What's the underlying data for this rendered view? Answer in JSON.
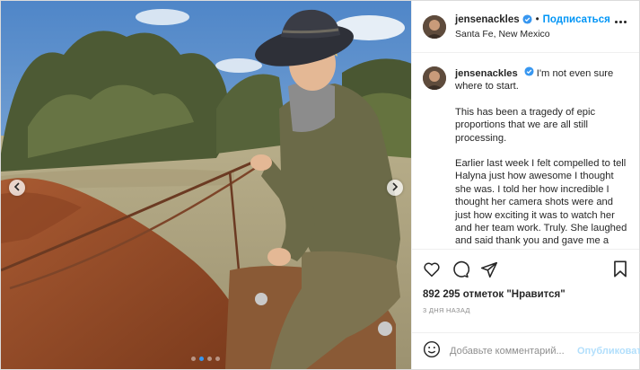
{
  "post": {
    "username": "jensenackles",
    "follow_label": "Подписаться",
    "separator": "•",
    "location": "Santa Fe, New Mexico"
  },
  "caption": {
    "username": "jensenackles",
    "first_line": "I'm not even sure where to start.",
    "paragraphs": [
      "This has been a tragedy of epic proportions that we are all still processing.",
      "Earlier last week I felt compelled to tell Halyna just how awesome I thought she was. I told her how incredible I thought her camera shots were and just how exciting it was to watch her and her team work. Truly. She laughed and said thank you and gave me a hug. I'll forever be thankful we had that moment.  She had a spunk and passion that infected the"
    ]
  },
  "engagement": {
    "likes_label": "892 295 отметок \"Нравится\"",
    "time_label": "3 ДНЯ НАЗАД"
  },
  "comment_box": {
    "placeholder": "Добавьте комментарий...",
    "publish_label": "Опубликовать"
  },
  "carousel": {
    "slide_count": 4,
    "active_index": 1
  },
  "icons": {
    "verified": "verified-badge-icon",
    "more": "more-options-icon",
    "like": "heart-icon",
    "comment": "comment-bubble-icon",
    "share": "paper-plane-icon",
    "save": "bookmark-icon",
    "emoji": "smiley-icon",
    "prev": "chevron-left-icon",
    "next": "chevron-right-icon"
  },
  "colors": {
    "accent": "#0095f6",
    "verified": "#3897f0",
    "publish_disabled": "#b2dffc",
    "muted": "#8e8e8e"
  }
}
